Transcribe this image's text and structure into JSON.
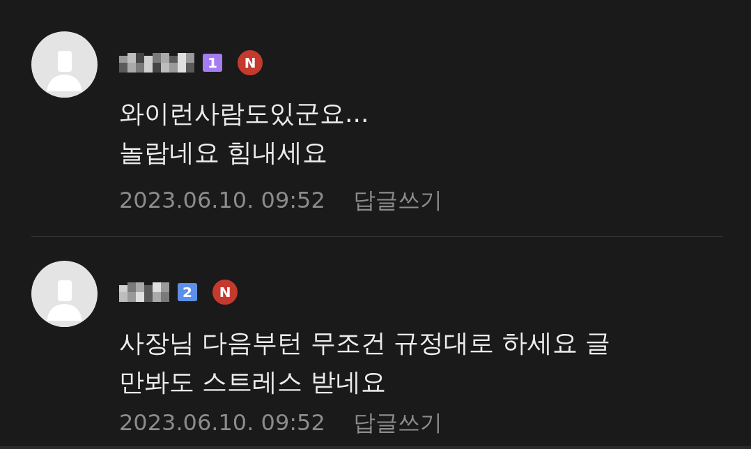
{
  "comments": [
    {
      "level_badge": {
        "text": "1",
        "color": "#a57cf2"
      },
      "new_badge": "N",
      "lines": [
        "와이런사람도있군요...",
        "놀랍네요 힘내세요"
      ],
      "date": "2023.06.10. 09:52",
      "reply_link": "답글쓰기"
    },
    {
      "level_badge": {
        "text": "2",
        "color": "#5c90e8"
      },
      "new_badge": "N",
      "lines": [
        "사장님 다음부턴 무조건 규정대로 하세요 글",
        "만봐도 스트레스 받네요"
      ],
      "date": "2023.06.10. 09:52",
      "reply_link": "답글쓰기"
    }
  ]
}
